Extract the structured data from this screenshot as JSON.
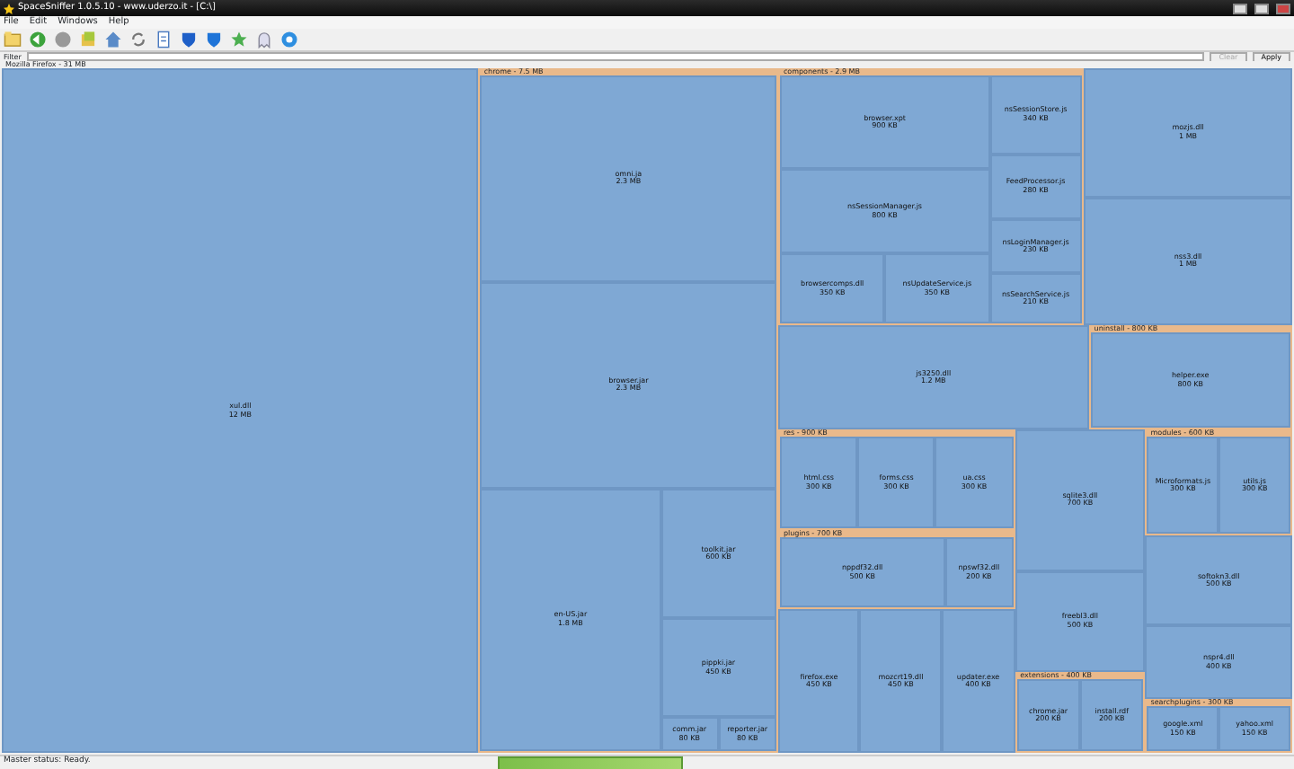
{
  "window": {
    "title": "SpaceSniffer 1.0.5.10 - www.uderzo.it - [C:\\]"
  },
  "menu": [
    "File",
    "Edit",
    "Windows",
    "Help"
  ],
  "filter": {
    "label": "Filter",
    "buttons": [
      {
        "label": "Clear",
        "disabled": true
      },
      {
        "label": "Apply",
        "disabled": false
      }
    ]
  },
  "tree": {
    "kind": "folder",
    "label": "Mozilla Firefox -",
    "size": "31 MB",
    "children": [
      {
        "kind": "file",
        "label": "xul.dll",
        "size": "12 MB"
      },
      {
        "kind": "folder",
        "label": "chrome -",
        "size": "7.5 MB",
        "children": [
          {
            "kind": "file",
            "label": "omni.ja",
            "size": "2.3 MB"
          },
          {
            "kind": "file",
            "label": "browser.jar",
            "size": "2.3 MB"
          },
          {
            "kind": "group",
            "children": [
              {
                "kind": "file",
                "label": "en-US.jar",
                "size": "1.8 MB"
              },
              {
                "kind": "group",
                "children": [
                  {
                    "kind": "file",
                    "label": "toolkit.jar",
                    "size": "600 KB"
                  },
                  {
                    "kind": "file",
                    "label": "pippki.jar",
                    "size": "450 KB"
                  },
                  {
                    "kind": "group",
                    "children": [
                      {
                        "kind": "file",
                        "label": "comm.jar",
                        "size": "80 KB"
                      },
                      {
                        "kind": "file",
                        "label": "reporter.jar",
                        "size": "80 KB"
                      }
                    ]
                  }
                ]
              }
            ]
          }
        ]
      },
      {
        "kind": "group",
        "children": [
          {
            "kind": "group",
            "children": [
              {
                "kind": "folder",
                "label": "components -",
                "size": "2.9 MB",
                "children": [
                  {
                    "kind": "group",
                    "children": [
                      {
                        "kind": "group",
                        "children": [
                          {
                            "kind": "file",
                            "label": "browser.xpt",
                            "size": "900 KB"
                          },
                          {
                            "kind": "file",
                            "label": "nsSessionManager.js",
                            "size": "800 KB"
                          },
                          {
                            "kind": "group",
                            "children": [
                              {
                                "kind": "file",
                                "label": "browsercomps.dll",
                                "size": "350 KB"
                              },
                              {
                                "kind": "file",
                                "label": "nsUpdateService.js",
                                "size": "350 KB"
                              }
                            ]
                          }
                        ]
                      },
                      {
                        "kind": "group",
                        "children": [
                          {
                            "kind": "file",
                            "label": "nsSessionStore.js",
                            "size": "340 KB"
                          },
                          {
                            "kind": "file",
                            "label": "FeedProcessor.js",
                            "size": "280 KB"
                          },
                          {
                            "kind": "file",
                            "label": "nsLoginManager.js",
                            "size": "230 KB"
                          },
                          {
                            "kind": "file",
                            "label": "nsSearchService.js",
                            "size": "210 KB"
                          }
                        ]
                      }
                    ]
                  }
                ]
              },
              {
                "kind": "group",
                "children": [
                  {
                    "kind": "file",
                    "label": "mozjs.dll",
                    "size": "1 MB"
                  },
                  {
                    "kind": "file",
                    "label": "nss3.dll",
                    "size": "1 MB"
                  }
                ]
              }
            ]
          },
          {
            "kind": "group",
            "children": [
              {
                "kind": "file",
                "label": "js3250.dll",
                "size": "1.2 MB"
              },
              {
                "kind": "folder",
                "label": "uninstall -",
                "size": "800 KB",
                "children": [
                  {
                    "kind": "file",
                    "label": "helper.exe",
                    "size": "800 KB"
                  }
                ]
              }
            ]
          },
          {
            "kind": "group",
            "children": [
              {
                "kind": "group",
                "children": [
                  {
                    "kind": "folder",
                    "label": "res -",
                    "size": "900 KB",
                    "children": [
                      {
                        "kind": "file",
                        "label": "html.css",
                        "size": "300 KB"
                      },
                      {
                        "kind": "file",
                        "label": "forms.css",
                        "size": "300 KB"
                      },
                      {
                        "kind": "file",
                        "label": "ua.css",
                        "size": "300 KB"
                      }
                    ]
                  },
                  {
                    "kind": "folder",
                    "label": "plugins -",
                    "size": "700 KB",
                    "children": [
                      {
                        "kind": "file",
                        "label": "nppdf32.dll",
                        "size": "500 KB"
                      },
                      {
                        "kind": "file",
                        "label": "npswf32.dll",
                        "size": "200 KB"
                      }
                    ]
                  },
                  {
                    "kind": "group",
                    "children": [
                      {
                        "kind": "file",
                        "label": "firefox.exe",
                        "size": "450 KB"
                      },
                      {
                        "kind": "file",
                        "label": "mozcrt19.dll",
                        "size": "450 KB"
                      },
                      {
                        "kind": "file",
                        "label": "updater.exe",
                        "size": "400 KB"
                      }
                    ]
                  }
                ]
              },
              {
                "kind": "group",
                "children": [
                  {
                    "kind": "file",
                    "label": "sqlite3.dll",
                    "size": "700 KB"
                  },
                  {
                    "kind": "file",
                    "label": "freebl3.dll",
                    "size": "500 KB"
                  },
                  {
                    "kind": "folder",
                    "label": "extensions -",
                    "size": "400 KB",
                    "children": [
                      {
                        "kind": "file",
                        "label": "chrome.jar",
                        "size": "200 KB"
                      },
                      {
                        "kind": "file",
                        "label": "install.rdf",
                        "size": "200 KB"
                      }
                    ]
                  }
                ]
              },
              {
                "kind": "group",
                "children": [
                  {
                    "kind": "folder",
                    "label": "modules -",
                    "size": "600 KB",
                    "children": [
                      {
                        "kind": "file",
                        "label": "Microformats.js",
                        "size": "300 KB"
                      },
                      {
                        "kind": "file",
                        "label": "utils.js",
                        "size": "300 KB"
                      }
                    ]
                  },
                  {
                    "kind": "file",
                    "label": "softokn3.dll",
                    "size": "500 KB"
                  },
                  {
                    "kind": "file",
                    "label": "nspr4.dll",
                    "size": "400 KB"
                  },
                  {
                    "kind": "folder",
                    "label": "searchplugins -",
                    "size": "300 KB",
                    "children": [
                      {
                        "kind": "file",
                        "label": "google.xml",
                        "size": "150 KB"
                      },
                      {
                        "kind": "file",
                        "label": "yahoo.xml",
                        "size": "150 KB"
                      }
                    ]
                  }
                ]
              }
            ]
          }
        ]
      }
    ]
  },
  "status_bar": "Master status: Ready."
}
